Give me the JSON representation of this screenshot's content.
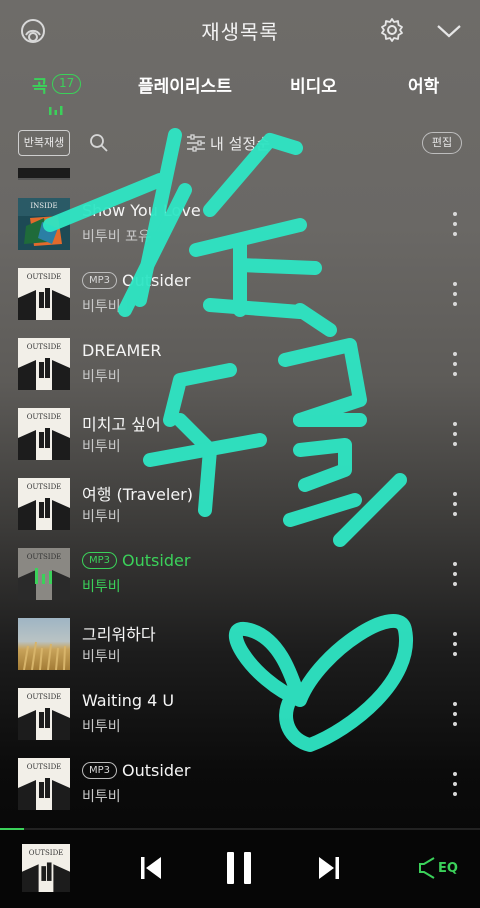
{
  "header": {
    "title": "재생목록"
  },
  "tabs": [
    {
      "label": "곡",
      "badge": "17"
    },
    {
      "label": "플레이리스트"
    },
    {
      "label": "비디오"
    },
    {
      "label": "어학"
    }
  ],
  "toolbar": {
    "repeat_label": "반복재생",
    "sort_label": "내 설정순",
    "edit_label": "편집"
  },
  "songs": [
    {
      "title": "Show You Love",
      "artist": "비투비 포유",
      "mp3": ""
    },
    {
      "title": "Outsider",
      "artist": "비투비",
      "mp3": "MP3"
    },
    {
      "title": "DREAMER",
      "artist": "비투비",
      "mp3": ""
    },
    {
      "title": "미치고 싶어",
      "artist": "비투비",
      "mp3": ""
    },
    {
      "title": "여행 (Traveler)",
      "artist": "비투비",
      "mp3": ""
    },
    {
      "title": "Outsider",
      "artist": "비투비",
      "mp3": "MP3"
    },
    {
      "title": "그리워하다",
      "artist": "비투비",
      "mp3": ""
    },
    {
      "title": "Waiting 4 U",
      "artist": "비투비",
      "mp3": ""
    },
    {
      "title": "Outsider",
      "artist": "비투비",
      "mp3": "MP3"
    }
  ],
  "covers": {
    "inside": "INSIDE",
    "outside": "OUTSIDE"
  },
  "player": {
    "eq_label": "EQ",
    "progress": 0.05
  },
  "colors": {
    "accent": "#3bd15a",
    "graffiti": "#2ee6c4"
  }
}
